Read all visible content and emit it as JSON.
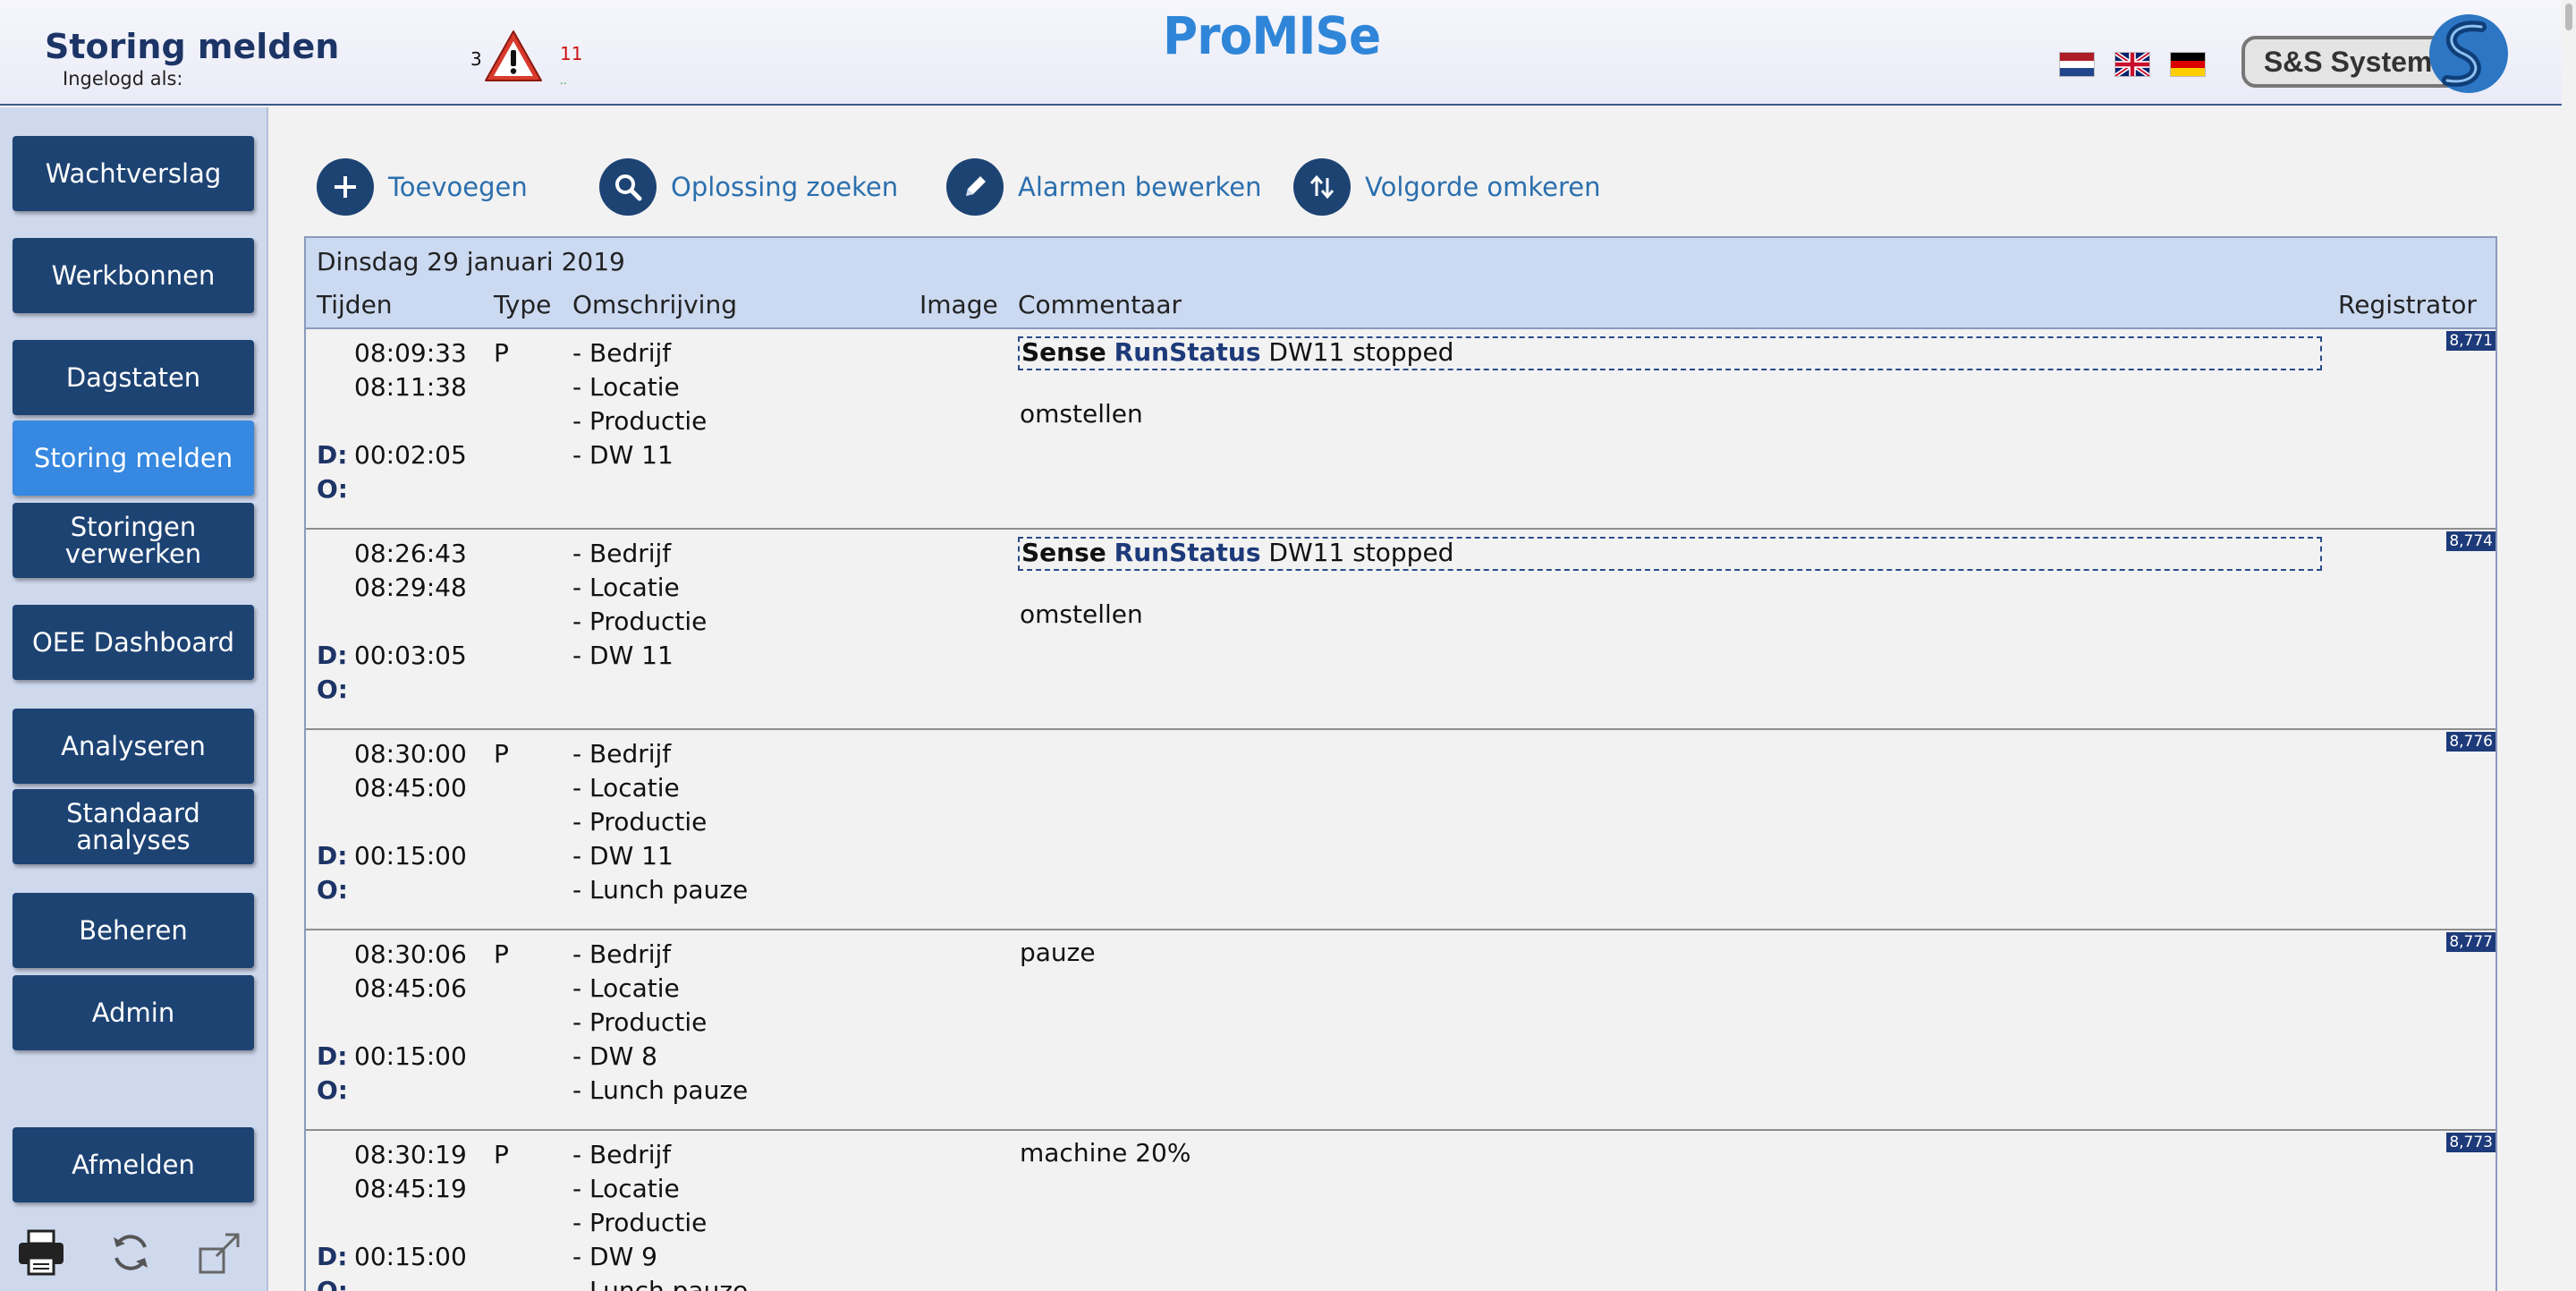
{
  "header": {
    "page_title": "Storing melden",
    "logged_in_label": "Ingelogd als:",
    "alarm_count_left": "3",
    "alarm_count_right": "11",
    "brand": "ProMISe",
    "company": "S&S Systems",
    "flags": [
      "dutch-flag-icon",
      "english-flag-icon",
      "german-flag-icon"
    ]
  },
  "sidebar": {
    "items": [
      {
        "label": "Wachtverslag"
      },
      {
        "label": "Werkbonnen"
      },
      {
        "label": "Dagstaten"
      },
      {
        "label": "Storing melden",
        "active": true
      },
      {
        "label": "Storingen verwerken"
      },
      {
        "label": "OEE Dashboard"
      },
      {
        "label": "Analyseren"
      },
      {
        "label": "Standaard analyses"
      },
      {
        "label": "Beheren"
      },
      {
        "label": "Admin"
      },
      {
        "label": "Afmelden"
      }
    ],
    "tools": [
      "printer-icon",
      "refresh-icon",
      "fullscreen-icon"
    ]
  },
  "toolbar": {
    "add": "Toevoegen",
    "search": "Oplossing zoeken",
    "edit_alarms": "Alarmen bewerken",
    "reverse_order": "Volgorde omkeren"
  },
  "table": {
    "date_heading": "Dinsdag 29 januari 2019",
    "columns": {
      "times": "Tijden",
      "type": "Type",
      "description": "Omschrijving",
      "image": "Image",
      "comment": "Commentaar",
      "registrar": "Registrator"
    },
    "duration_label": "D:",
    "other_label": "O:",
    "rows": [
      {
        "start": "08:09:33",
        "end": "08:11:38",
        "duration": "00:02:05",
        "type": "P",
        "description": [
          "- Bedrijf",
          "- Locatie",
          "- Productie",
          "- DW 11"
        ],
        "sense": {
          "source": "Sense",
          "key": "RunStatus",
          "text": "DW11 stopped"
        },
        "comment": "omstellen",
        "registrar": "8,771"
      },
      {
        "start": "08:26:43",
        "end": "08:29:48",
        "duration": "00:03:05",
        "type": "",
        "description": [
          "- Bedrijf",
          "- Locatie",
          "- Productie",
          "- DW 11"
        ],
        "sense": {
          "source": "Sense",
          "key": "RunStatus",
          "text": "DW11 stopped"
        },
        "comment": "omstellen",
        "registrar": "8,774"
      },
      {
        "start": "08:30:00",
        "end": "08:45:00",
        "duration": "00:15:00",
        "type": "P",
        "description": [
          "- Bedrijf",
          "- Locatie",
          "- Productie",
          "- DW 11",
          "- Lunch pauze"
        ],
        "comment": "",
        "registrar": "8,776"
      },
      {
        "start": "08:30:06",
        "end": "08:45:06",
        "duration": "00:15:00",
        "type": "P",
        "description": [
          "- Bedrijf",
          "- Locatie",
          "- Productie",
          "- DW 8",
          "- Lunch pauze"
        ],
        "comment": "pauze",
        "registrar": "8,777"
      },
      {
        "start": "08:30:19",
        "end": "08:45:19",
        "duration": "00:15:00",
        "type": "P",
        "description": [
          "- Bedrijf",
          "- Locatie",
          "- Productie",
          "- DW 9",
          "- Lunch pauze"
        ],
        "comment": "machine 20%",
        "registrar": "8,773"
      }
    ]
  },
  "colors": {
    "nav_button": "#1d4373",
    "nav_active": "#3688e0",
    "sidebar_bg": "#cfd9ee",
    "table_head_bg": "#cbd9f1",
    "brand": "#2f86d8",
    "link": "#2b6fae"
  }
}
